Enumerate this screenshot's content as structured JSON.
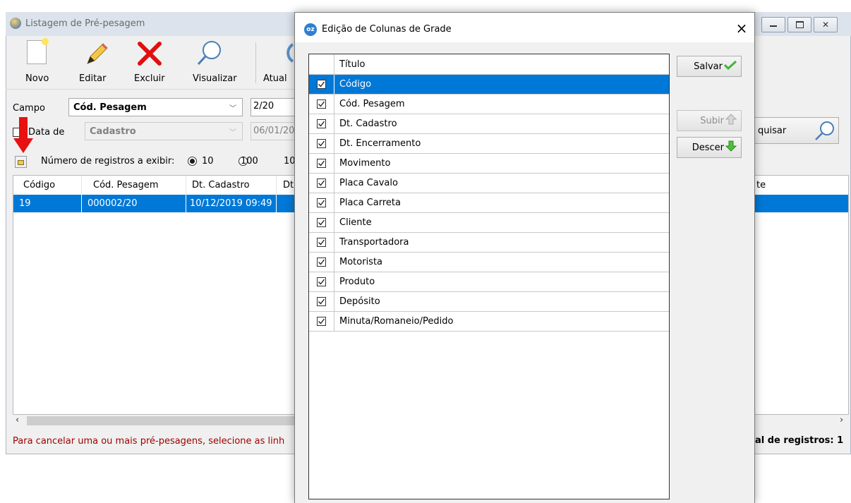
{
  "background_window": {
    "title": "Listagem de Pré-pesagem",
    "toolbar": {
      "novo": "Novo",
      "editar": "Editar",
      "excluir": "Excluir",
      "visualizar": "Visualizar",
      "atualizar": "Atual"
    },
    "filters": {
      "campo_label": "Campo",
      "campo_value": "Cód. Pesagem",
      "campo_text": "2/20",
      "data_label": "Data de",
      "data_value": "Cadastro",
      "data_date": "06/01/202",
      "pesquisar": "quisar"
    },
    "records": {
      "label": "Número de registros a exibir:",
      "options": [
        "10",
        "100",
        "10"
      ],
      "selected": "10"
    },
    "grid": {
      "headers": [
        "Código",
        "Cód. Pesagem",
        "Dt. Cadastro",
        "Dt.",
        "te"
      ],
      "row": [
        "19",
        "000002/20",
        "10/12/2019 09:49"
      ]
    },
    "status": {
      "message": "Para cancelar uma ou mais pré-pesagens, selecione as linh",
      "total": "al de registros: 1"
    }
  },
  "dialog": {
    "title": "Edição de Colunas de Grade",
    "close": "×",
    "list_header": "Título",
    "items": [
      {
        "label": "Código",
        "checked": true,
        "selected": true
      },
      {
        "label": "Cód. Pesagem",
        "checked": true
      },
      {
        "label": "Dt. Cadastro",
        "checked": true
      },
      {
        "label": "Dt. Encerramento",
        "checked": true
      },
      {
        "label": "Movimento",
        "checked": true
      },
      {
        "label": "Placa Cavalo",
        "checked": true
      },
      {
        "label": "Placa Carreta",
        "checked": true
      },
      {
        "label": "Cliente",
        "checked": true
      },
      {
        "label": "Transportadora",
        "checked": true
      },
      {
        "label": "Motorista",
        "checked": true
      },
      {
        "label": "Produto",
        "checked": true
      },
      {
        "label": "Depósito",
        "checked": true
      },
      {
        "label": "Minuta/Romaneio/Pedido",
        "checked": true
      }
    ],
    "buttons": {
      "salvar": "Salvar",
      "subir": "Subir",
      "descer": "Descer"
    }
  },
  "colors": {
    "selection": "#0078d7",
    "status_text": "#a00000",
    "arrow_red": "#e81010",
    "green_icon": "#3cb82e"
  }
}
